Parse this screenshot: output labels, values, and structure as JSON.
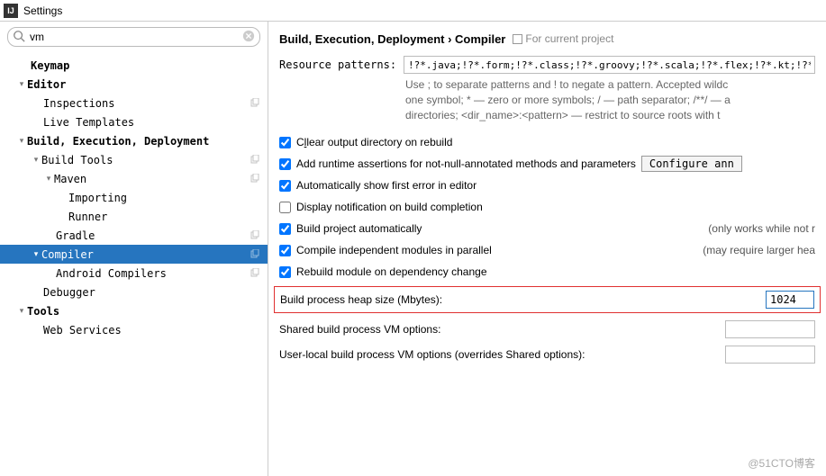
{
  "title": "Settings",
  "search": {
    "value": "vm"
  },
  "tree": {
    "keymap": "Keymap",
    "editor": "Editor",
    "inspections": "Inspections",
    "live_templates": "Live Templates",
    "bed": "Build, Execution, Deployment",
    "build_tools": "Build Tools",
    "maven": "Maven",
    "importing": "Importing",
    "runner": "Runner",
    "gradle": "Gradle",
    "compiler": "Compiler",
    "android_compilers": "Android Compilers",
    "debugger": "Debugger",
    "tools": "Tools",
    "web_services": "Web Services"
  },
  "breadcrumb": {
    "path": "Build, Execution, Deployment › Compiler",
    "scope": "For current project"
  },
  "resource": {
    "label": "Resource patterns:",
    "value": "!?*.java;!?*.form;!?*.class;!?*.groovy;!?*.scala;!?*.flex;!?*.kt;!?*.clj;!?*.a",
    "help_l1": "Use ; to separate patterns and ! to negate a pattern. Accepted wildc",
    "help_l2": "one symbol; * — zero or more symbols; / — path separator; /**/ — a",
    "help_l3": "directories; <dir_name>:<pattern> — restrict to source roots with t"
  },
  "checks": {
    "clear": "lear output directory on rebuild",
    "assertions": "Add runtime assertions for not-null-annotated methods and parameters",
    "configure": "Configure ann",
    "first_error": "Automatically show first error in editor",
    "notify": "Display notification on build completion",
    "auto": "Build project automatically",
    "auto_note": "(only works while not r",
    "parallel": "Compile independent modules in parallel",
    "parallel_note": "(may require larger hea",
    "rebuild_dep": "Rebuild module on dependency change"
  },
  "heap": {
    "label": "Build process heap size (Mbytes):",
    "value": "1024"
  },
  "shared": {
    "label": "Shared build process VM options:",
    "value": ""
  },
  "user": {
    "label": "User-local build process VM options (overrides Shared options):",
    "value": ""
  },
  "watermark": "@51CTO博客"
}
